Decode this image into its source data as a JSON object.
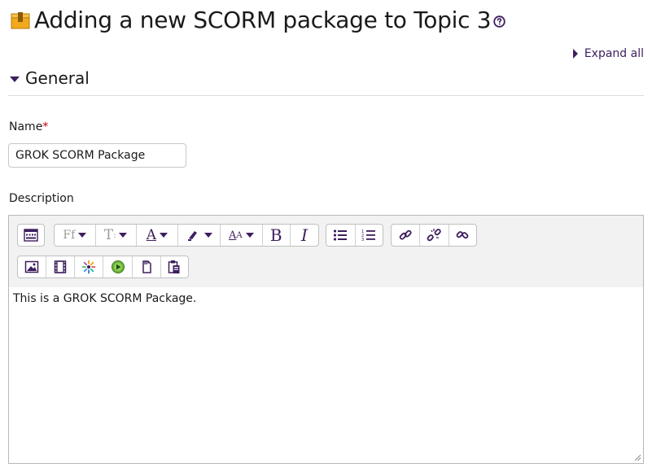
{
  "header": {
    "title": "Adding a new SCORM package to Topic 3",
    "module_icon": "scorm-package-icon",
    "help_icon": "question-circle-icon"
  },
  "expand_all": {
    "label": "Expand all"
  },
  "section": {
    "title": "General"
  },
  "name_field": {
    "label": "Name",
    "required_mark": "*",
    "value": "GROK SCORM Package"
  },
  "description_field": {
    "label": "Description",
    "content": "This is a GROK SCORM Package."
  },
  "toolbar": {
    "row1": [
      {
        "icon": "toolbar-toggle-icon"
      },
      {
        "icon": "font-family-icon",
        "text": "Ff"
      },
      {
        "icon": "font-size-icon",
        "text": "T"
      },
      {
        "icon": "font-color-icon",
        "text": "A"
      },
      {
        "icon": "background-color-icon"
      },
      {
        "icon": "paragraph-styles-icon",
        "text": "A"
      },
      {
        "icon": "bold-icon",
        "text": "B"
      },
      {
        "icon": "italic-icon",
        "text": "I"
      },
      {
        "icon": "unordered-list-icon"
      },
      {
        "icon": "ordered-list-icon"
      },
      {
        "icon": "link-icon"
      },
      {
        "icon": "unlink-icon"
      },
      {
        "icon": "anchor-link-icon"
      }
    ],
    "row2": [
      {
        "icon": "image-icon"
      },
      {
        "icon": "media-icon"
      },
      {
        "icon": "sunburst-icon"
      },
      {
        "icon": "recordrtc-icon"
      },
      {
        "icon": "copy-icon"
      },
      {
        "icon": "paste-icon"
      }
    ]
  },
  "colors": {
    "accent": "#3d1e5e",
    "required": "#c00000",
    "toolbar_bg": "#f2f2f2",
    "border": "#b8b8b8"
  }
}
